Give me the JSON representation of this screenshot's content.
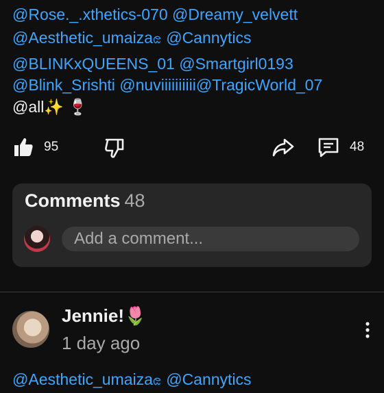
{
  "post": {
    "mention_lines": [
      {
        "text": "@Rose._.xthetics-070 @Dreamy_velvett"
      },
      {
        "text": "@Aesthetic_umaizaၕ @Cannytics"
      },
      {
        "text": "@BLINKxQUEENS_01 @Smartgirl0193"
      },
      {
        "text": "@Blink_Srishti @nuviiiiiiiiii@TragicWorld_07"
      }
    ],
    "last_line": {
      "mention": "@all",
      "emoji": "✨ 🍷"
    }
  },
  "actions": {
    "like_count": "95",
    "comment_count": "48"
  },
  "comments_section": {
    "title": "Comments",
    "count": "48",
    "add_placeholder": "Add a comment..."
  },
  "comment": {
    "author": "Jennie!🌷",
    "time": "1 day ago",
    "text": "@Aesthetic_umaizaၕ @Cannytics"
  },
  "colors": {
    "background": "#0f0f0f",
    "mention": "#3ea6ff",
    "card": "#272727",
    "muted": "#aaaaaa"
  },
  "icons": {
    "like": "thumbs-up-icon",
    "dislike": "thumbs-down-icon",
    "share": "share-arrow-icon",
    "comments": "comment-bubble-icon",
    "more": "vertical-dots-icon"
  }
}
